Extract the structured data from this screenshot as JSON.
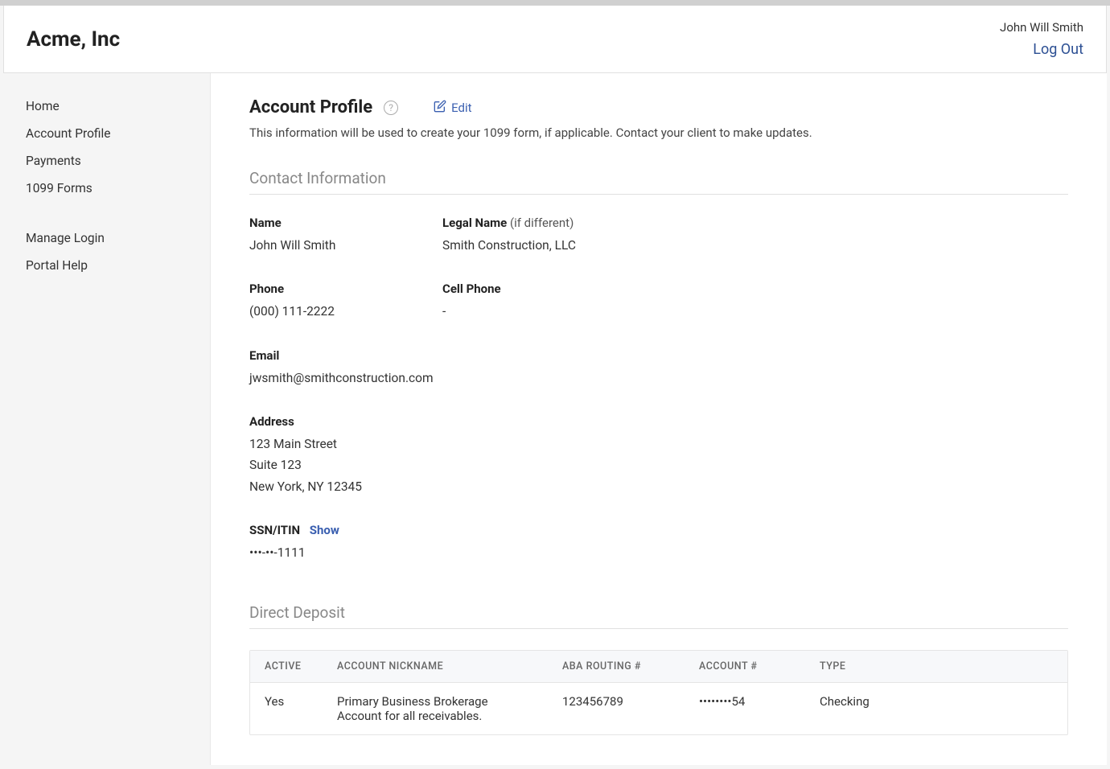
{
  "header": {
    "company_name": "Acme, Inc",
    "user_name": "John Will Smith",
    "logout_label": "Log Out"
  },
  "sidebar": {
    "group1": [
      {
        "label": "Home",
        "key": "home"
      },
      {
        "label": "Account Profile",
        "key": "account-profile"
      },
      {
        "label": "Payments",
        "key": "payments"
      },
      {
        "label": "1099 Forms",
        "key": "1099-forms"
      }
    ],
    "group2": [
      {
        "label": "Manage Login",
        "key": "manage-login"
      },
      {
        "label": "Portal Help",
        "key": "portal-help"
      }
    ]
  },
  "page": {
    "title": "Account Profile",
    "edit_label": "Edit",
    "subtitle": "This information will be used to create your 1099 form, if applicable. Contact your client to make updates."
  },
  "contact_section": {
    "title": "Contact Information",
    "name_label": "Name",
    "name_value": "John Will Smith",
    "legal_name_label": "Legal Name",
    "legal_name_hint": "(if different)",
    "legal_name_value": "Smith Construction, LLC",
    "phone_label": "Phone",
    "phone_value": "(000) 111-2222",
    "cell_phone_label": "Cell Phone",
    "cell_phone_value": "-",
    "email_label": "Email",
    "email_value": "jwsmith@smithconstruction.com",
    "address_label": "Address",
    "address_line1": "123 Main Street",
    "address_line2": "Suite 123",
    "address_line3": "New York, NY 12345",
    "ssn_label": "SSN/ITIN",
    "ssn_show_label": "Show",
    "ssn_value": "•••-••-1111"
  },
  "deposit_section": {
    "title": "Direct Deposit",
    "columns": {
      "active": "ACTIVE",
      "nickname": "ACCOUNT NICKNAME",
      "routing": "ABA ROUTING #",
      "account": "ACCOUNT #",
      "type": "TYPE"
    },
    "rows": [
      {
        "active": "Yes",
        "nickname": "Primary Business Brokerage Account for all receivables.",
        "routing": "123456789",
        "account": "••••••••54",
        "type": "Checking"
      }
    ]
  }
}
